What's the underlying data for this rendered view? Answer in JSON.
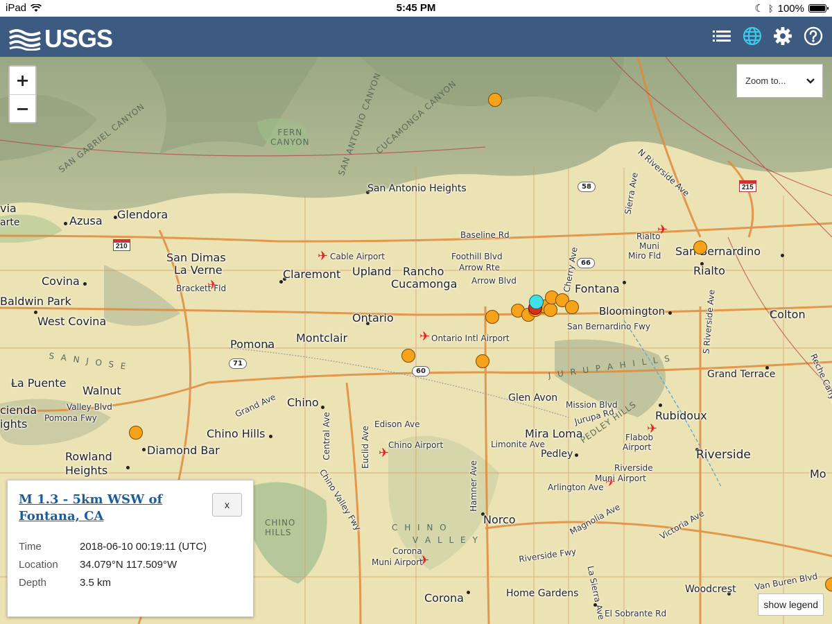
{
  "status_bar": {
    "device": "iPad",
    "time": "5:45 PM",
    "battery": "100%",
    "battery_level": 1.0
  },
  "header": {
    "logo": "USGS",
    "bg_color": "#3d5a80",
    "icons": [
      "list-icon",
      "globe-icon",
      "gear-icon",
      "help-icon"
    ]
  },
  "map": {
    "zoom_in": "+",
    "zoom_out": "−",
    "zoom_to": {
      "label": "Zoom to..."
    },
    "show_legend": "show legend",
    "places": {
      "san_antonio_heights": "San Antonio Heights",
      "azusa": "Azusa",
      "glendora": "Glendora",
      "via": "via",
      "arte": "arte",
      "san_dimas": "San Dimas",
      "la_verne": "La Verne",
      "covina": "Covina",
      "baldwin_park": "Baldwin Park",
      "west_covina": "West Covina",
      "claremont": "Claremont",
      "upland": "Upland",
      "rancho": "Rancho",
      "cucamonga": "Cucamonga",
      "fontana": "Fontana",
      "rialto": "Rialto",
      "san_bernardino": "San Bernardino",
      "bloomington": "Bloomington",
      "colton": "Colton",
      "ontario": "Ontario",
      "pomona": "Pomona",
      "montclair": "Montclair",
      "la_puente": "La Puente",
      "walnut": "Walnut",
      "cienda": "cienda",
      "ights": "ights",
      "chino": "Chino",
      "chino_hills": "Chino Hills",
      "diamond_bar": "Diamond Bar",
      "rowland": "Rowland",
      "heights": "Heights",
      "glen_avon": "Glen Avon",
      "mira_loma": "Mira Loma",
      "pedley": "Pedley",
      "rubidoux": "Rubidoux",
      "grand_terrace": "Grand Terrace",
      "riverside": "Riverside",
      "mo": "Mo",
      "norco": "Norco",
      "corona": "Corona",
      "home_gardens": "Home Gardens",
      "woodcrest": "Woodcrest"
    },
    "small_labels": {
      "baseline_rd": "Baseline Rd",
      "foothill_blvd": "Foothill Blvd",
      "arrow_rte": "Arrow Rte",
      "arrow_blvd": "Arrow Blvd",
      "sb_fwy": "San Bernardino Fwy",
      "valley_blvd": "Valley Blvd",
      "pomona_fwy": "Pomona Fwy",
      "grand_ave": "Grand Ave",
      "edison_ave": "Edison Ave",
      "mission_blvd": "Mission Blvd",
      "jurupa_rd": "Jurupa Rd",
      "limonite_ave": "Limonite Ave",
      "arlington_ave": "Arlington Ave",
      "magnolia_ave": "Magnolia Ave",
      "victoria_ave": "Victoria Ave",
      "riverside_fwy": "Riverside Fwy",
      "van_buren_blvd": "Van Buren Blvd",
      "el_sobrante_rd": "El Sobrante Rd",
      "cherry_ave": "Cherry Ave",
      "sierra_ave": "Sierra Ave",
      "central_ave": "Central Ave",
      "euclid_ave": "Euclid Ave",
      "hamner_ave": "Hamner Ave",
      "n_riverside_ave": "N Riverside Ave",
      "s_riverside_ave": "S Riverside Ave",
      "chino_valley_fwy": "Chino Valley Fwy",
      "la_sierra_ave": "La Sierra Ave",
      "reche_canyon_rd": "Reche Canyon Rd"
    },
    "airports": {
      "cable": "Cable Airport",
      "brackett": "Brackett Fld",
      "ontario_intl": "Ontario Intl Airport",
      "chino_airport": "Chino Airport",
      "rialto_muni_1": "Rialto",
      "rialto_muni_2": "Muni",
      "rialto_muni_3": "Miro Fld",
      "flabob_1": "Flabob",
      "flabob_2": "Airport",
      "riverside_muni_1": "Riverside",
      "riverside_muni_2": "Muni Airport",
      "corona_muni_1": "Corona",
      "corona_muni_2": "Muni Airport"
    },
    "terrain": {
      "fern_canyon_1": "FERN",
      "fern_canyon_2": "CANYON",
      "san_jose_hills": "S A N   J O S E",
      "jurupa_hills": "J U R U P A   H I L L S",
      "chino_valley_1": "C H I N O",
      "chino_valley_2": "V A L L E Y",
      "chino_hills_1": "CHINO",
      "chino_hills_2": "HILLS",
      "cucamonga_canyon": "CUCAMONGA CANYON",
      "san_antonio_canyon": "SAN ANTONIO CANYON",
      "san_gabriel_canyon": "SAN GABRIEL CANYON",
      "pedley_hills": "PEDLEY HILLS"
    },
    "shields": {
      "sr58": "58",
      "i215": "215",
      "i210": "210",
      "sr66": "66",
      "sr71": "71",
      "sr60": "60"
    },
    "quake_colors": {
      "older": "#f7a21b",
      "selected": "#40e0e8",
      "recent": "#d8331a"
    }
  },
  "popup": {
    "title": "M 1.3 - 5km WSW of Fontana, CA",
    "close": "x",
    "rows": [
      {
        "key": "Time",
        "value": "2018-06-10 00:19:11 (UTC)"
      },
      {
        "key": "Location",
        "value": "34.079°N 117.509°W"
      },
      {
        "key": "Depth",
        "value": "3.5 km"
      }
    ]
  }
}
